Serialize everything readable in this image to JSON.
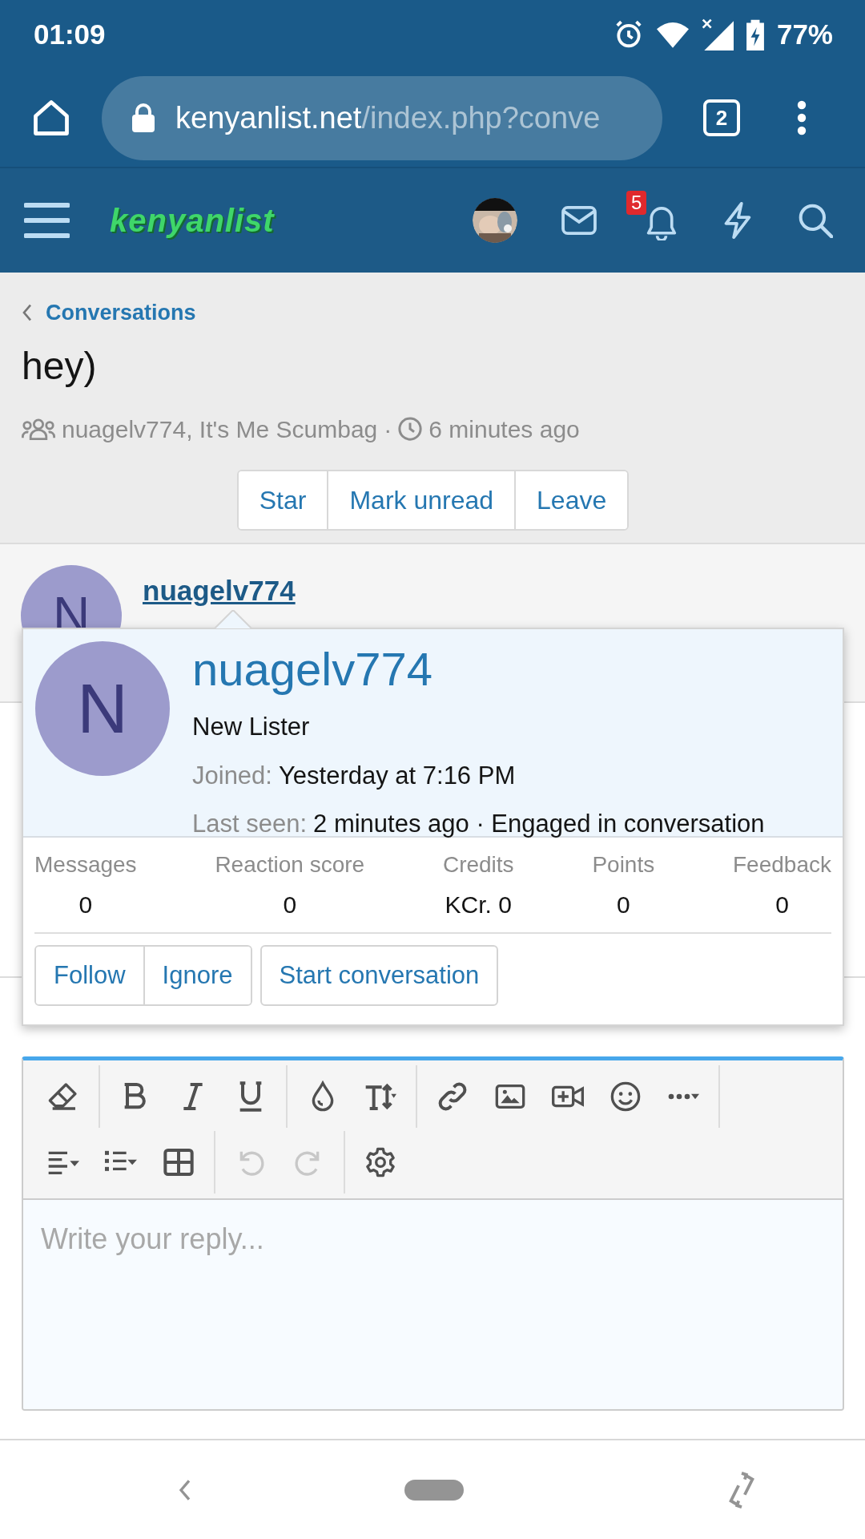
{
  "status_bar": {
    "time": "01:09",
    "battery": "77%"
  },
  "browser": {
    "url_domain": "kenyanlist.net",
    "url_path": "/index.php?conve",
    "tab_count": "2"
  },
  "site_header": {
    "logo": "kenyanlist",
    "notification_count": "5"
  },
  "breadcrumb": {
    "label": "Conversations"
  },
  "conversation": {
    "title": "hey)",
    "participants": "nuagelv774, It's Me Scumbag",
    "separator": "·",
    "time": "6 minutes ago",
    "actions": [
      {
        "label": "Star"
      },
      {
        "label": "Mark unread"
      },
      {
        "label": "Leave"
      }
    ]
  },
  "message": {
    "avatar_letter": "N",
    "username": "nuagelv774"
  },
  "profile_popup": {
    "avatar_letter": "N",
    "username": "nuagelv774",
    "title": "New Lister",
    "info": [
      {
        "label": "Joined:",
        "value": "Yesterday at 7:16 PM"
      },
      {
        "label": "Last seen:",
        "value": "2 minutes ago · Engaged in conversation"
      }
    ],
    "stats": [
      {
        "label": "Messages",
        "value": "0"
      },
      {
        "label": "Reaction score",
        "value": "0"
      },
      {
        "label": "Credits",
        "value": "KCr. 0"
      },
      {
        "label": "Points",
        "value": "0"
      },
      {
        "label": "Feedback",
        "value": "0"
      }
    ],
    "follow_buttons": [
      {
        "label": "Follow"
      },
      {
        "label": "Ignore"
      }
    ],
    "conversation_button": {
      "label": "Start conversation"
    }
  },
  "editor": {
    "toolbar": [
      [
        [
          {
            "disabled": false
          }
        ],
        [
          {
            "disabled": false
          },
          {
            "disabled": false
          },
          {
            "disabled": false
          }
        ],
        [
          {
            "disabled": false
          },
          {
            "disabled": false
          }
        ],
        [
          {
            "disabled": false
          },
          {
            "disabled": false
          },
          {
            "disabled": false
          },
          {
            "disabled": false
          },
          {
            "disabled": false
          }
        ]
      ],
      [
        [
          {
            "disabled": false
          },
          {
            "disabled": false
          },
          {
            "disabled": false
          }
        ],
        [
          {
            "disabled": true
          },
          {
            "disabled": true
          }
        ],
        [
          {
            "disabled": false
          }
        ]
      ]
    ],
    "placeholder": "Write your reply..."
  }
}
